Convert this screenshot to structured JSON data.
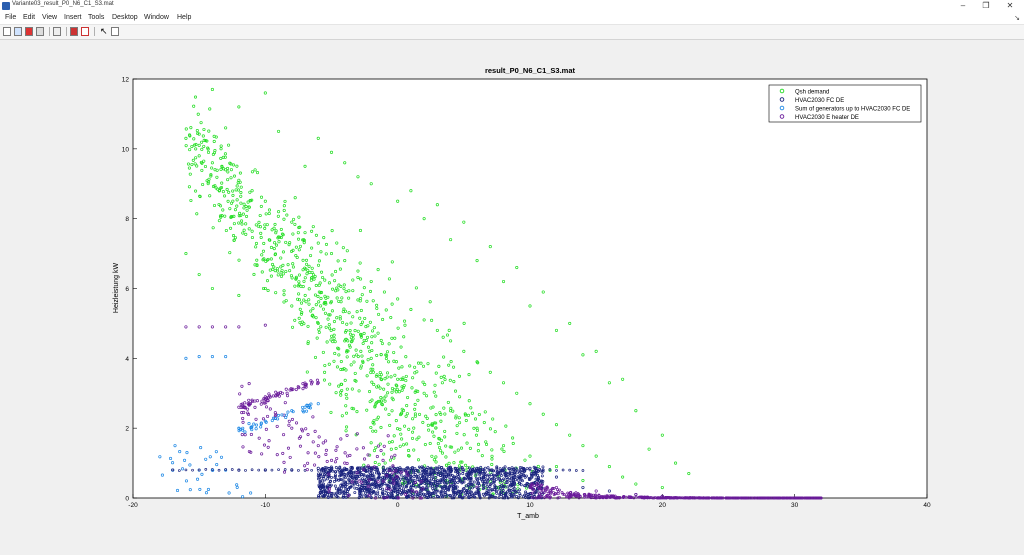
{
  "window": {
    "title": "Variante03_result_P0_N6_C1_S3.mat",
    "minimize_glyph": "–",
    "restore_glyph": "❐",
    "close_glyph": "✕"
  },
  "menu": {
    "items": [
      "File",
      "Edit",
      "View",
      "Insert",
      "Tools",
      "Desktop",
      "Window",
      "Help"
    ],
    "dock_glyph": "↘"
  },
  "toolbar": {
    "icons": [
      "new-figure-icon",
      "open-file-icon",
      "save-icon",
      "print-icon",
      "print-preview-icon",
      "insert-colorbar-icon",
      "insert-legend-icon",
      "edit-plot-icon",
      "show-plot-tools-icon"
    ]
  },
  "colors": {
    "background": "#f0f0f0",
    "axes": "#ffffff",
    "demand": "#22dd22",
    "fc": "#1a237e",
    "sum": "#1e88e5",
    "eheater": "#6a1b9a"
  },
  "chart_data": {
    "type": "scatter",
    "title": "result_P0_N6_C1_S3.mat",
    "xlabel": "T_amb",
    "ylabel": "Heizleistung kW",
    "xlim": [
      -20,
      40
    ],
    "ylim": [
      0,
      12
    ],
    "xticks": [
      -20,
      -10,
      0,
      10,
      20,
      30,
      40
    ],
    "yticks": [
      0,
      2,
      4,
      6,
      8,
      10,
      12
    ],
    "grid": false,
    "legend_position": "top-right",
    "series": [
      {
        "name": "Qsh demand",
        "marker": "circle",
        "color": "#22dd22",
        "points": [
          [
            -16,
            10.3
          ],
          [
            -15,
            10.1
          ],
          [
            -14,
            11.7
          ],
          [
            -13,
            10.6
          ],
          [
            -12,
            11.2
          ],
          [
            -10,
            11.6
          ],
          [
            -9,
            10.5
          ],
          [
            -15,
            9.8
          ],
          [
            -14,
            9.6
          ],
          [
            -13,
            9.4
          ],
          [
            -12,
            9.1
          ],
          [
            -11,
            8.8
          ],
          [
            -10,
            8.5
          ],
          [
            -9,
            8.2
          ],
          [
            -8,
            7.9
          ],
          [
            -7,
            7.6
          ],
          [
            -6,
            7.3
          ],
          [
            -5,
            7.0
          ],
          [
            -4,
            6.8
          ],
          [
            -3,
            6.5
          ],
          [
            -2,
            6.2
          ],
          [
            -1,
            5.9
          ],
          [
            0,
            5.7
          ],
          [
            1,
            5.4
          ],
          [
            2,
            5.1
          ],
          [
            3,
            4.8
          ],
          [
            4,
            4.5
          ],
          [
            5,
            4.2
          ],
          [
            6,
            3.9
          ],
          [
            7,
            3.6
          ],
          [
            8,
            3.3
          ],
          [
            9,
            3.0
          ],
          [
            10,
            2.7
          ],
          [
            11,
            2.4
          ],
          [
            12,
            2.1
          ],
          [
            13,
            1.8
          ],
          [
            14,
            1.5
          ],
          [
            15,
            1.2
          ],
          [
            16,
            0.9
          ],
          [
            17,
            0.6
          ],
          [
            18,
            0.4
          ],
          [
            20,
            0.3
          ],
          [
            -16,
            7.0
          ],
          [
            -15,
            6.4
          ],
          [
            -14,
            6.0
          ],
          [
            -12,
            5.8
          ],
          [
            -10,
            6.0
          ],
          [
            -8,
            5.5
          ],
          [
            -6,
            5.0
          ],
          [
            -4,
            4.5
          ],
          [
            -2,
            4.0
          ],
          [
            0,
            3.4
          ],
          [
            2,
            3.0
          ],
          [
            4,
            2.5
          ],
          [
            6,
            2.0
          ],
          [
            8,
            1.5
          ],
          [
            10,
            1.2
          ],
          [
            12,
            0.9
          ],
          [
            14,
            0.5
          ],
          [
            -6,
            10.3
          ],
          [
            -4,
            9.6
          ],
          [
            -2,
            9.0
          ],
          [
            0,
            8.5
          ],
          [
            2,
            8.0
          ],
          [
            4,
            7.4
          ],
          [
            6,
            6.8
          ],
          [
            8,
            6.2
          ],
          [
            10,
            5.5
          ],
          [
            12,
            4.8
          ],
          [
            14,
            4.1
          ],
          [
            16,
            3.3
          ],
          [
            18,
            2.5
          ],
          [
            20,
            1.8
          ],
          [
            21,
            1.0
          ],
          [
            22,
            0.7
          ],
          [
            19,
            1.4
          ],
          [
            -7,
            9.5
          ],
          [
            -5,
            9.9
          ],
          [
            -3,
            9.2
          ],
          [
            1,
            8.8
          ],
          [
            3,
            8.4
          ],
          [
            5,
            7.9
          ],
          [
            7,
            7.2
          ],
          [
            9,
            6.6
          ],
          [
            11,
            5.9
          ],
          [
            13,
            5.0
          ],
          [
            15,
            4.2
          ],
          [
            17,
            3.4
          ]
        ],
        "density": "dense diagonal band from (-16,10) to (22,0), peak density near 0–10 °C"
      },
      {
        "name": "HVAC2030 FC DE",
        "marker": "circle",
        "color": "#1a237e",
        "points": [
          [
            -17,
            0.8
          ],
          [
            -14,
            0.8
          ],
          [
            -12,
            0.8
          ],
          [
            -10,
            0.8
          ],
          [
            -8,
            0.8
          ],
          [
            -6,
            0.85
          ],
          [
            -4,
            0.85
          ],
          [
            -2,
            0.85
          ],
          [
            0,
            0.85
          ],
          [
            2,
            0.85
          ],
          [
            4,
            0.85
          ],
          [
            6,
            0.85
          ],
          [
            8,
            0.85
          ],
          [
            10,
            0.85
          ],
          [
            12,
            0.6
          ],
          [
            14,
            0.3
          ],
          [
            16,
            0.2
          ],
          [
            18,
            0.1
          ],
          [
            20,
            0.05
          ],
          [
            25,
            0.0
          ],
          [
            30,
            0.0
          ]
        ],
        "density": "horizontal band near 0.8 kW, dense dark block from -6 to 11 °C"
      },
      {
        "name": "Sum of generators up to HVAC2030 FC DE",
        "marker": "circle",
        "color": "#1e88e5",
        "points": [
          [
            -16,
            4.0
          ],
          [
            -15,
            4.05
          ],
          [
            -14,
            4.05
          ],
          [
            -13,
            4.05
          ],
          [
            -12,
            2.0
          ],
          [
            -10,
            2.2
          ],
          [
            -8,
            2.5
          ],
          [
            -7,
            2.6
          ],
          [
            -6,
            2.7
          ],
          [
            -17,
            0.8
          ],
          [
            -15,
            0.8
          ],
          [
            -13,
            0.8
          ]
        ]
      },
      {
        "name": "HVAC2030 E heater DE",
        "marker": "circle",
        "color": "#6a1b9a",
        "points": [
          [
            -16,
            4.9
          ],
          [
            -15,
            4.9
          ],
          [
            -14,
            4.9
          ],
          [
            -13,
            4.9
          ],
          [
            -12,
            4.9
          ],
          [
            -10,
            4.95
          ],
          [
            -12,
            2.6
          ],
          [
            -11,
            2.8
          ],
          [
            -10,
            2.9
          ],
          [
            -9,
            3.0
          ],
          [
            -8,
            3.1
          ],
          [
            -7,
            3.2
          ],
          [
            -6,
            3.3
          ],
          [
            -8,
            2.0
          ],
          [
            -6,
            1.5
          ],
          [
            -4,
            1.0
          ],
          [
            -2,
            0.8
          ],
          [
            0,
            0.6
          ],
          [
            2,
            0.5
          ],
          [
            4,
            0.4
          ],
          [
            6,
            0.3
          ],
          [
            8,
            0.4
          ],
          [
            10,
            0.3
          ],
          [
            12,
            0.3
          ],
          [
            15,
            0.2
          ],
          [
            18,
            0.1
          ],
          [
            20,
            0.05
          ],
          [
            22,
            0.0
          ],
          [
            25,
            0.0
          ],
          [
            28,
            0.0
          ],
          [
            30,
            0.0
          ],
          [
            32,
            0.0
          ]
        ]
      }
    ]
  }
}
